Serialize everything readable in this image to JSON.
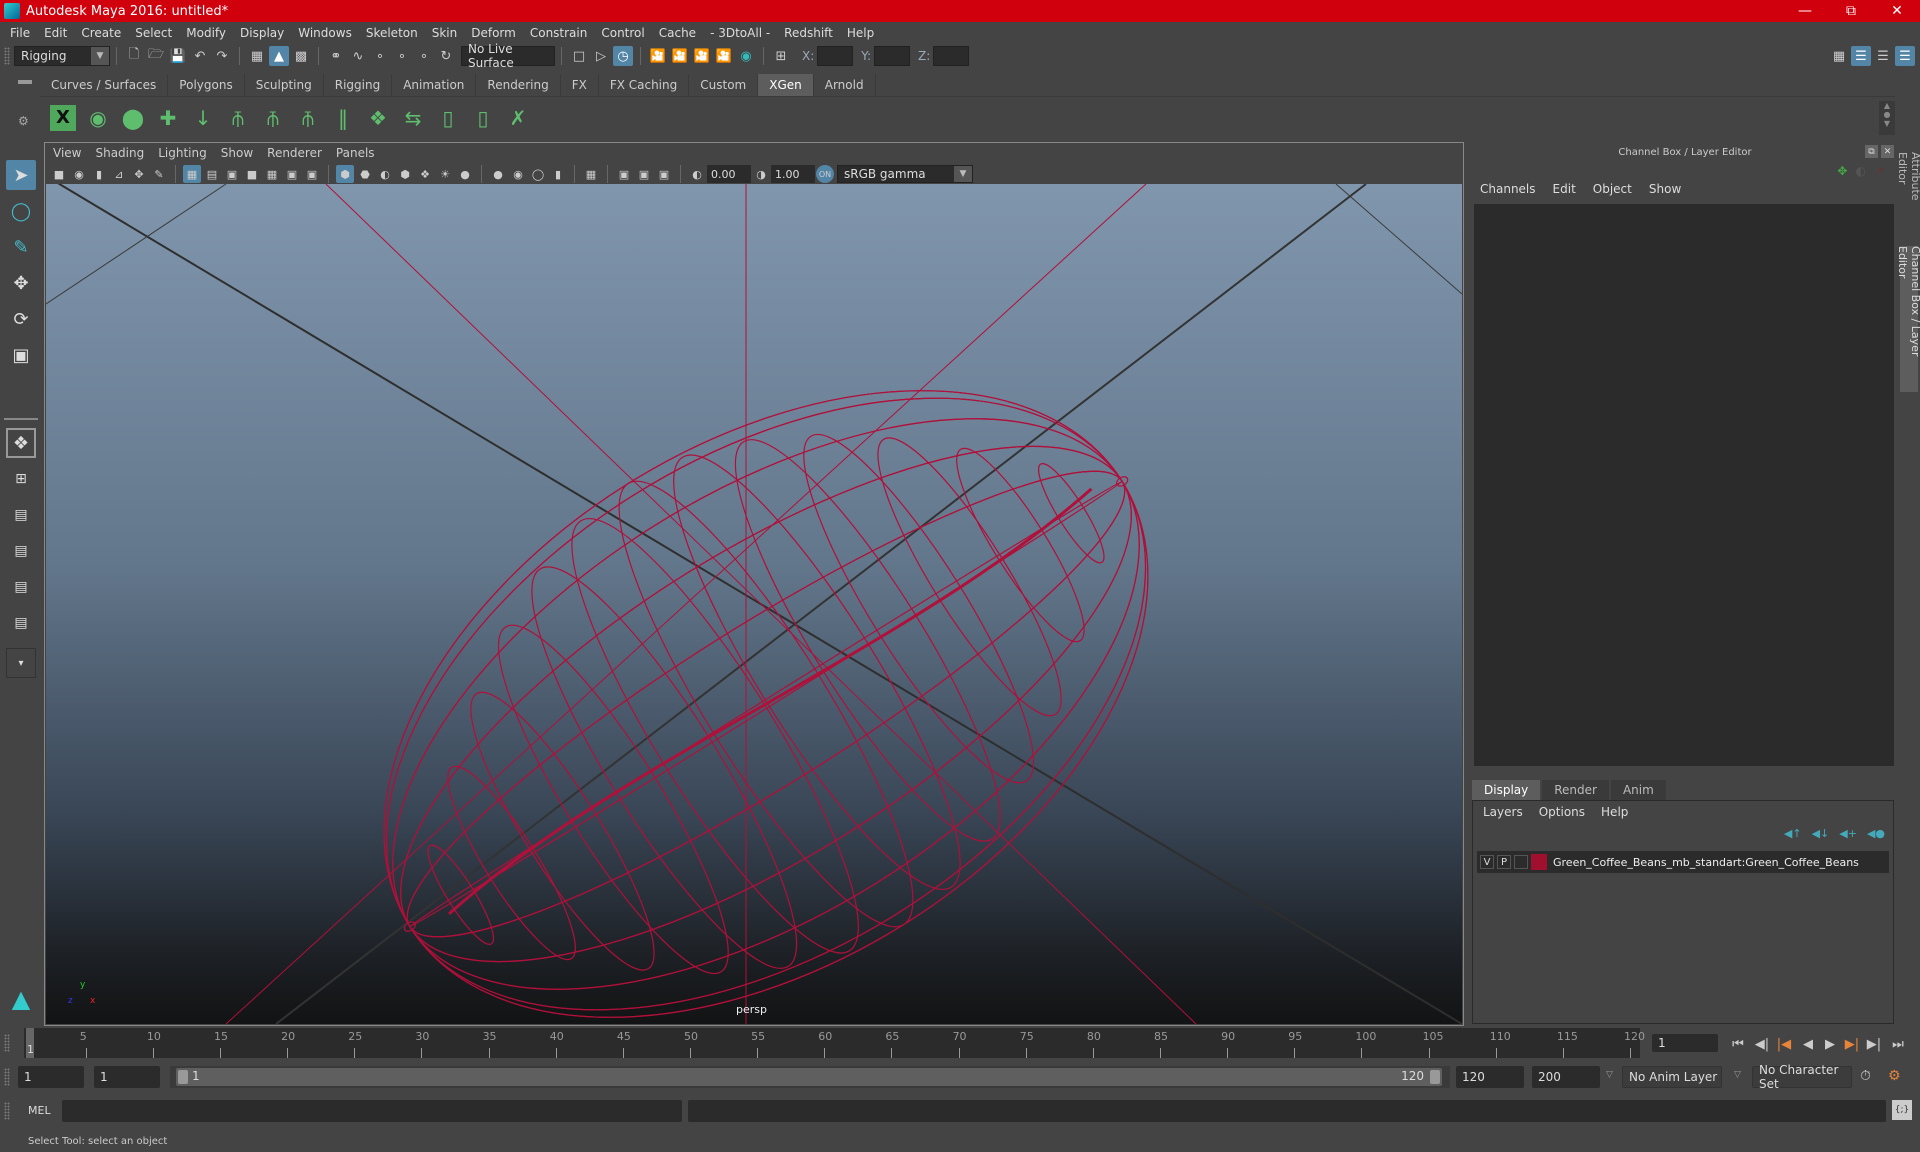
{
  "window": {
    "title": "Autodesk Maya 2016: untitled*",
    "controls": [
      "minimize",
      "restore",
      "close"
    ]
  },
  "menubar": [
    "File",
    "Edit",
    "Create",
    "Select",
    "Modify",
    "Display",
    "Windows",
    "Skeleton",
    "Skin",
    "Deform",
    "Constrain",
    "Control",
    "Cache",
    "- 3DtoAll -",
    "Redshift",
    "Help"
  ],
  "statusline": {
    "mode": "Rigging",
    "live_surface": "No Live Surface",
    "x_label": "X:",
    "y_label": "Y:",
    "z_label": "Z:",
    "x_value": "",
    "y_value": "",
    "z_value": ""
  },
  "shelf": {
    "tabs": [
      "Curves / Surfaces",
      "Polygons",
      "Sculpting",
      "Rigging",
      "Animation",
      "Rendering",
      "FX",
      "FX Caching",
      "Custom",
      "XGen",
      "Arnold"
    ],
    "active_tab": "XGen",
    "icons": [
      "xgen-window-icon",
      "xgen-visibility-icon",
      "xgen-hide-icon",
      "xgen-add-guides-icon",
      "xgen-place-icon",
      "xgen-add-guide-icon",
      "xgen-view-guide-icon",
      "xgen-lock-guide-icon",
      "xgen-bend-guide-icon",
      "xgen-density-icon",
      "xgen-flip-guide-icon",
      "xgen-select-guide-icon",
      "xgen-guide-cage-icon",
      "xgen-delete-guide-icon"
    ]
  },
  "viewport": {
    "menu": [
      "View",
      "Shading",
      "Lighting",
      "Show",
      "Renderer",
      "Panels"
    ],
    "exposure": "0.00",
    "gamma": "1.00",
    "color_space": "sRGB gamma",
    "camera_label": "persp",
    "axis": {
      "x": "x",
      "y": "y",
      "z": "z"
    },
    "wire_color": "#b0103a"
  },
  "channel_box": {
    "title": "Channel Box / Layer Editor",
    "menu": [
      "Channels",
      "Edit",
      "Object",
      "Show"
    ]
  },
  "layer_editor": {
    "tabs": [
      "Display",
      "Render",
      "Anim"
    ],
    "active_tab": "Display",
    "menu": [
      "Layers",
      "Options",
      "Help"
    ],
    "layers": [
      {
        "visible": "V",
        "playback": "P",
        "color": "#a0102e",
        "name": "Green_Coffee_Beans_mb_standart:Green_Coffee_Beans"
      }
    ]
  },
  "side_tabs": [
    "Attribute Editor",
    "Channel Box / Layer Editor"
  ],
  "timeline": {
    "start": 1,
    "end": 120,
    "labels": [
      5,
      10,
      15,
      20,
      25,
      30,
      35,
      40,
      45,
      50,
      55,
      60,
      65,
      70,
      75,
      80,
      85,
      90,
      95,
      100,
      105,
      110,
      115,
      120
    ],
    "current_frame_marker": "1",
    "current_frame": "1"
  },
  "range": {
    "start_time": "1",
    "playback_start": "1",
    "slider_start": "1",
    "slider_end": "120",
    "playback_end": "120",
    "end_time": "200",
    "anim_layer": "No Anim Layer",
    "character_set": "No Character Set"
  },
  "command_line": {
    "label": "MEL",
    "input": "",
    "output": ""
  },
  "help_line": "Select Tool: select an object"
}
